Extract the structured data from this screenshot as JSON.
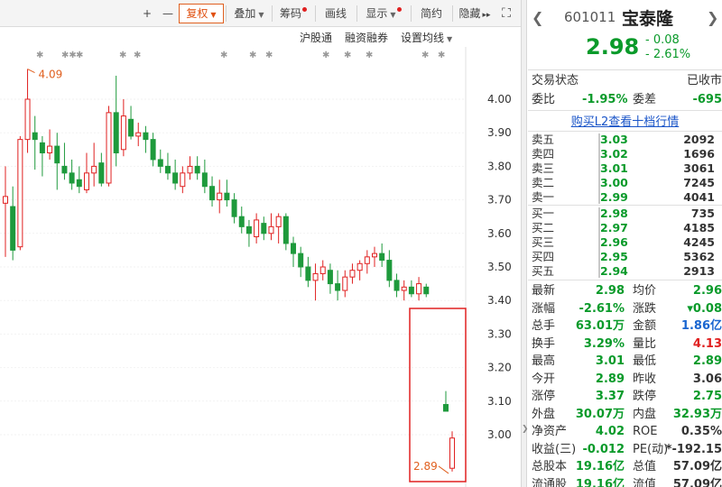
{
  "toolbar": {
    "plus": "+",
    "minus": "—",
    "fuquan": "复权",
    "diejia": "叠加",
    "chouma": "筹码",
    "huaxian": "画线",
    "xianshi": "显示",
    "jianyue": "简约",
    "yincang": "隐藏",
    "yincang_arrow": "▸▸",
    "fullscreen": "⛶"
  },
  "subbar": {
    "hugutong": "沪股通",
    "rongzi": "融资融券",
    "junxian": "设置均线"
  },
  "chart_data": {
    "type": "candlestick",
    "y_ticks": [
      "4.00",
      "3.90",
      "3.80",
      "3.70",
      "3.60",
      "3.50",
      "3.40",
      "3.30",
      "3.20",
      "3.10",
      "3.00"
    ],
    "ylim": [
      2.86,
      4.15
    ],
    "high_label": "4.09",
    "low_label": "2.89",
    "markers": [
      "✱",
      "✱✱",
      "✱",
      "✱",
      "✱",
      "✱",
      "✱",
      "✱",
      "✱",
      "✱",
      "✱",
      "✱",
      "✱"
    ],
    "colors": {
      "up": "#e02020",
      "down": "#1e9a3c",
      "axis": "#333333",
      "highlight": "#e02020",
      "annot": "#e06020"
    },
    "candles": [
      {
        "o": 3.69,
        "h": 3.8,
        "l": 3.53,
        "c": 3.71
      },
      {
        "o": 3.68,
        "h": 3.74,
        "l": 3.52,
        "c": 3.55
      },
      {
        "o": 3.56,
        "h": 3.89,
        "l": 3.55,
        "c": 3.88
      },
      {
        "o": 3.88,
        "h": 4.09,
        "l": 3.84,
        "c": 4.0
      },
      {
        "o": 3.9,
        "h": 3.95,
        "l": 3.79,
        "c": 3.88
      },
      {
        "o": 3.87,
        "h": 3.89,
        "l": 3.77,
        "c": 3.84
      },
      {
        "o": 3.84,
        "h": 3.91,
        "l": 3.82,
        "c": 3.86
      },
      {
        "o": 3.86,
        "h": 3.9,
        "l": 3.73,
        "c": 3.81
      },
      {
        "o": 3.8,
        "h": 3.87,
        "l": 3.76,
        "c": 3.78
      },
      {
        "o": 3.78,
        "h": 3.82,
        "l": 3.73,
        "c": 3.75
      },
      {
        "o": 3.76,
        "h": 3.8,
        "l": 3.72,
        "c": 3.74
      },
      {
        "o": 3.73,
        "h": 3.84,
        "l": 3.72,
        "c": 3.78
      },
      {
        "o": 3.78,
        "h": 3.87,
        "l": 3.74,
        "c": 3.8
      },
      {
        "o": 3.81,
        "h": 3.84,
        "l": 3.74,
        "c": 3.75
      },
      {
        "o": 3.75,
        "h": 3.98,
        "l": 3.74,
        "c": 3.96
      },
      {
        "o": 3.96,
        "h": 4.07,
        "l": 3.8,
        "c": 3.84
      },
      {
        "o": 3.85,
        "h": 4.0,
        "l": 3.83,
        "c": 3.95
      },
      {
        "o": 3.94,
        "h": 3.98,
        "l": 3.88,
        "c": 3.89
      },
      {
        "o": 3.89,
        "h": 3.93,
        "l": 3.86,
        "c": 3.9
      },
      {
        "o": 3.9,
        "h": 3.92,
        "l": 3.84,
        "c": 3.88
      },
      {
        "o": 3.88,
        "h": 3.9,
        "l": 3.8,
        "c": 3.82
      },
      {
        "o": 3.82,
        "h": 3.85,
        "l": 3.78,
        "c": 3.8
      },
      {
        "o": 3.8,
        "h": 3.84,
        "l": 3.76,
        "c": 3.78
      },
      {
        "o": 3.78,
        "h": 3.82,
        "l": 3.73,
        "c": 3.75
      },
      {
        "o": 3.74,
        "h": 3.8,
        "l": 3.72,
        "c": 3.78
      },
      {
        "o": 3.78,
        "h": 3.83,
        "l": 3.76,
        "c": 3.8
      },
      {
        "o": 3.8,
        "h": 3.83,
        "l": 3.76,
        "c": 3.78
      },
      {
        "o": 3.78,
        "h": 3.82,
        "l": 3.72,
        "c": 3.74
      },
      {
        "o": 3.74,
        "h": 3.77,
        "l": 3.68,
        "c": 3.7
      },
      {
        "o": 3.7,
        "h": 3.76,
        "l": 3.66,
        "c": 3.72
      },
      {
        "o": 3.72,
        "h": 3.76,
        "l": 3.68,
        "c": 3.7
      },
      {
        "o": 3.7,
        "h": 3.72,
        "l": 3.63,
        "c": 3.65
      },
      {
        "o": 3.65,
        "h": 3.68,
        "l": 3.6,
        "c": 3.62
      },
      {
        "o": 3.62,
        "h": 3.64,
        "l": 3.56,
        "c": 3.6
      },
      {
        "o": 3.59,
        "h": 3.66,
        "l": 3.57,
        "c": 3.64
      },
      {
        "o": 3.63,
        "h": 3.65,
        "l": 3.58,
        "c": 3.6
      },
      {
        "o": 3.6,
        "h": 3.66,
        "l": 3.58,
        "c": 3.62
      },
      {
        "o": 3.62,
        "h": 3.66,
        "l": 3.57,
        "c": 3.65
      },
      {
        "o": 3.65,
        "h": 3.66,
        "l": 3.55,
        "c": 3.57
      },
      {
        "o": 3.57,
        "h": 3.59,
        "l": 3.5,
        "c": 3.54
      },
      {
        "o": 3.54,
        "h": 3.56,
        "l": 3.47,
        "c": 3.5
      },
      {
        "o": 3.5,
        "h": 3.53,
        "l": 3.44,
        "c": 3.46
      },
      {
        "o": 3.46,
        "h": 3.51,
        "l": 3.4,
        "c": 3.48
      },
      {
        "o": 3.48,
        "h": 3.52,
        "l": 3.46,
        "c": 3.5
      },
      {
        "o": 3.49,
        "h": 3.51,
        "l": 3.42,
        "c": 3.45
      },
      {
        "o": 3.45,
        "h": 3.49,
        "l": 3.4,
        "c": 3.43
      },
      {
        "o": 3.43,
        "h": 3.49,
        "l": 3.41,
        "c": 3.47
      },
      {
        "o": 3.47,
        "h": 3.51,
        "l": 3.45,
        "c": 3.49
      },
      {
        "o": 3.49,
        "h": 3.52,
        "l": 3.46,
        "c": 3.51
      },
      {
        "o": 3.51,
        "h": 3.55,
        "l": 3.48,
        "c": 3.53
      },
      {
        "o": 3.53,
        "h": 3.56,
        "l": 3.5,
        "c": 3.54
      },
      {
        "o": 3.54,
        "h": 3.57,
        "l": 3.5,
        "c": 3.52
      },
      {
        "o": 3.52,
        "h": 3.55,
        "l": 3.44,
        "c": 3.46
      },
      {
        "o": 3.46,
        "h": 3.48,
        "l": 3.41,
        "c": 3.43
      },
      {
        "o": 3.43,
        "h": 3.46,
        "l": 3.4,
        "c": 3.44
      },
      {
        "o": 3.44,
        "h": 3.46,
        "l": 3.41,
        "c": 3.42
      },
      {
        "o": 3.42,
        "h": 3.47,
        "l": 3.4,
        "c": 3.45
      },
      {
        "o": 3.44,
        "h": 3.45,
        "l": 3.41,
        "c": 3.42
      }
    ],
    "today": [
      {
        "o": 3.09,
        "h": 3.13,
        "l": 3.07,
        "c": 3.07
      },
      {
        "o": 2.9,
        "h": 3.01,
        "l": 2.89,
        "c": 2.99
      }
    ]
  },
  "panel": {
    "nav_left": "❮",
    "nav_right": "❯",
    "code": "601011",
    "name": "宝泰隆",
    "price": "2.98",
    "change": "- 0.08",
    "change_pct": "- 2.61%",
    "trade_status_label": "交易状态",
    "trade_status_value": "已收市",
    "weibi_label": "委比",
    "weibi_value": "-1.95%",
    "weicha_label": "委差",
    "weicha_value": "-695",
    "l2_link": "购买L2查看十档行情",
    "sells": [
      {
        "label": "卖五",
        "price": "3.03",
        "vol": "2092"
      },
      {
        "label": "卖四",
        "price": "3.02",
        "vol": "1696"
      },
      {
        "label": "卖三",
        "price": "3.01",
        "vol": "3061"
      },
      {
        "label": "卖二",
        "price": "3.00",
        "vol": "7245"
      },
      {
        "label": "卖一",
        "price": "2.99",
        "vol": "4041"
      }
    ],
    "buys": [
      {
        "label": "买一",
        "price": "2.98",
        "vol": "735"
      },
      {
        "label": "买二",
        "price": "2.97",
        "vol": "4185"
      },
      {
        "label": "买三",
        "price": "2.96",
        "vol": "4245"
      },
      {
        "label": "买四",
        "price": "2.95",
        "vol": "5362"
      },
      {
        "label": "买五",
        "price": "2.94",
        "vol": "2913"
      }
    ],
    "stats": [
      {
        "k1": "最新",
        "v1": "2.98",
        "c1": "green",
        "k2": "均价",
        "v2": "2.96",
        "c2": "green"
      },
      {
        "k1": "涨幅",
        "v1": "-2.61%",
        "c1": "green",
        "k2": "涨跌",
        "v2": "▾0.08",
        "c2": "green"
      },
      {
        "k1": "总手",
        "v1": "63.01万",
        "c1": "gray",
        "k2": "金额",
        "v2": "1.86亿",
        "c2": "blue"
      },
      {
        "k1": "换手",
        "v1": "3.29%",
        "c1": "gray",
        "k2": "量比",
        "v2": "4.13",
        "c2": "red"
      },
      {
        "k1": "最高",
        "v1": "3.01",
        "c1": "green",
        "k2": "最低",
        "v2": "2.89",
        "c2": "green"
      },
      {
        "k1": "今开",
        "v1": "2.89",
        "c1": "green",
        "k2": "昨收",
        "v2": "3.06",
        "c2": "gray"
      },
      {
        "k1": "涨停",
        "v1": "3.37",
        "c1": "red",
        "k2": "跌停",
        "v2": "2.75",
        "c2": "green"
      },
      {
        "k1": "外盘",
        "v1": "30.07万",
        "c1": "red",
        "k2": "内盘",
        "v2": "32.93万",
        "c2": "green"
      },
      {
        "k1": "净资产",
        "v1": "4.02",
        "c1": "gray",
        "k2": "ROE",
        "v2": "0.35%",
        "c2": "gray"
      },
      {
        "k1": "收益(三)",
        "v1": "-0.012",
        "c1": "gray",
        "k2": "PE(动)",
        "v2": "*-192.15",
        "c2": "gray"
      },
      {
        "k1": "总股本",
        "v1": "19.16亿",
        "c1": "gray",
        "k2": "总值",
        "v2": "57.09亿",
        "c2": "gray"
      },
      {
        "k1": "流通股",
        "v1": "19.16亿",
        "c1": "gray",
        "k2": "流值",
        "v2": "57.09亿",
        "c2": "gray"
      }
    ]
  }
}
